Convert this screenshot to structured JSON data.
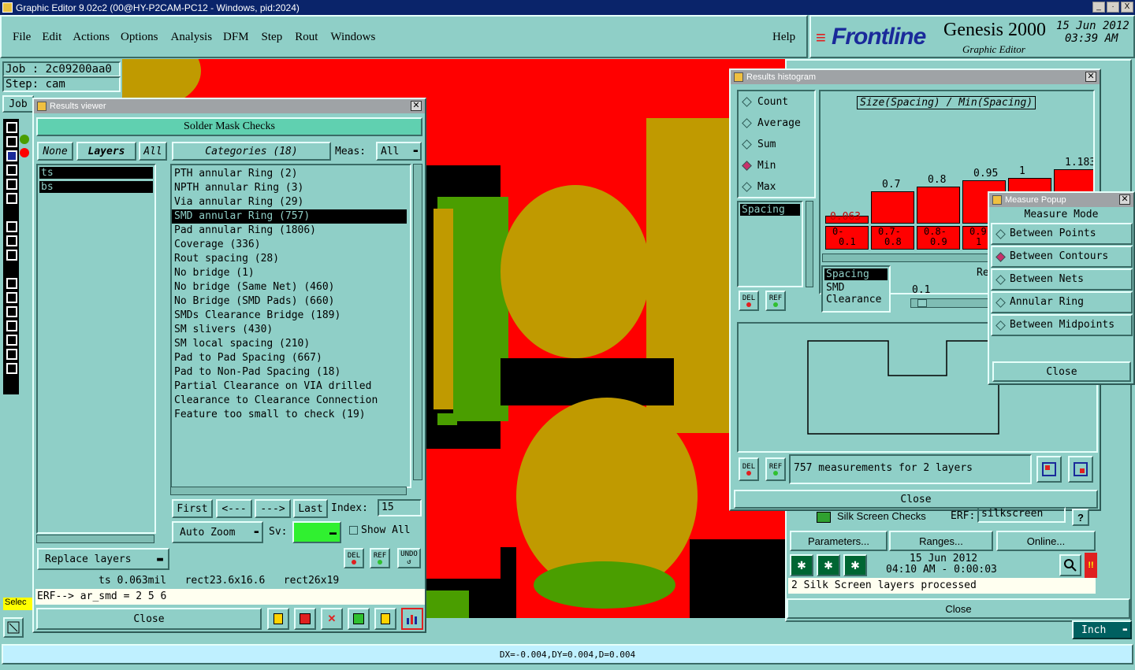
{
  "app": {
    "title": "Graphic Editor 9.02c2 (00@HY-P2CAM-PC12 - Windows, pid:2024)",
    "win_controls": [
      "_",
      "·",
      "X"
    ]
  },
  "menu": [
    "File",
    "Edit",
    "Actions",
    "Options",
    "Analysis",
    "DFM",
    "Step",
    "Rout",
    "Windows"
  ],
  "help_label": "Help",
  "brand": {
    "logo": "Frontline",
    "product": "Genesis 2000",
    "subtitle": "Graphic Editor",
    "date": "15 Jun 2012",
    "time": "03:39 AM"
  },
  "job_panel": {
    "job": "Job : 2c09200aa0",
    "step": "Step: cam",
    "job_btn": "Job",
    "select_label": "Selec"
  },
  "results_viewer": {
    "title": "Results viewer",
    "header": "Solder Mask Checks",
    "none_btn": "None",
    "layers_btn": "Layers",
    "all_btn": "All",
    "layers": [
      "ts",
      "bs"
    ],
    "categories_btn": "Categories (18)",
    "meas_label": "Meas:",
    "meas_value": "All",
    "categories": [
      "PTH annular Ring (2)",
      "NPTH annular Ring (3)",
      "Via annular Ring (29)",
      "SMD annular Ring (757)",
      "Pad annular Ring (1806)",
      "Coverage (336)",
      "Rout spacing (28)",
      "No bridge (1)",
      "No bridge (Same Net) (460)",
      "No Bridge (SMD Pads) (660)",
      "SMDs Clearance Bridge (189)",
      "SM slivers (430)",
      "SM local spacing (210)",
      "Pad to Pad Spacing (667)",
      "Pad to Non-Pad Spacing (18)",
      "Partial Clearance on VIA drilled",
      "Clearance to Clearance Connection",
      "Feature too small to check (19)"
    ],
    "selected_index": 3,
    "first_btn": "First",
    "prev_btn": "<---",
    "next_btn": "--->",
    "last_btn": "Last",
    "index_label": "Index:",
    "index_value": "15",
    "auto_zoom": "Auto Zoom",
    "sv_label": "Sv:",
    "show_all": "Show All",
    "replace_layers": "Replace layers",
    "del": "DEL",
    "ref": "REF",
    "undo": "UNDO",
    "status": "ts 0.063mil   rect23.6x16.6   rect26x19",
    "erf": "ERF--> ar_smd = 2 5 6",
    "close": "Close"
  },
  "histogram": {
    "title": "Results histogram",
    "modes": [
      "Count",
      "Average",
      "Sum",
      "Min",
      "Max"
    ],
    "selected_mode": 3,
    "chart_title": "Size(Spacing) / Min(Spacing)",
    "spacing_item": "Spacing",
    "bars": [
      {
        "label": "0.063",
        "range": [
          "0-",
          "0.1"
        ],
        "value": 0.063
      },
      {
        "label": "0.7",
        "range": [
          "0.7-",
          "0.8"
        ],
        "value": 0.7
      },
      {
        "label": "0.8",
        "range": [
          "0.8-",
          "0.9"
        ],
        "value": 0.8
      },
      {
        "label": "0.95",
        "range": [
          "0.9-",
          "1"
        ],
        "value": 0.95
      },
      {
        "label": "1",
        "range": [
          "",
          ""
        ],
        "value": 1
      },
      {
        "label": "1.183",
        "range": [
          "",
          ""
        ],
        "value": 1.183
      }
    ],
    "meas_list": [
      "Spacing",
      "SMD",
      "Clearance"
    ],
    "res_label": "Rese",
    "slider_value": "0.1",
    "measurements": "757 measurements for 2 layers",
    "close": "Close",
    "del": "DEL",
    "ref": "REF"
  },
  "measure_popup": {
    "title": "Measure Popup",
    "header": "Measure Mode",
    "options": [
      "Between Points",
      "Between Contours",
      "Between Nets",
      "Annular Ring",
      "Between Midpoints"
    ],
    "selected": 1,
    "close": "Close"
  },
  "checklist": {
    "silk_row": "Silk Screen Checks",
    "erf_label": "ERF:",
    "erf_value": "silkscreen",
    "q": "?",
    "parameters": "Parameters...",
    "ranges": "Ranges...",
    "online": "Online...",
    "date": "15 Jun 2012",
    "time": "04:10 AM - 0:00:03",
    "status": "2 Silk Screen layers processed",
    "close": "Close",
    "excl": "!!"
  },
  "units": "Inch",
  "coords": "DX=-0.004,DY=0.004,D=0.004",
  "colors": {
    "teal": "#8fcfc7",
    "red": "#ff0000",
    "gold": "#c09a00",
    "green": "#4a9e00",
    "black": "#000000"
  }
}
